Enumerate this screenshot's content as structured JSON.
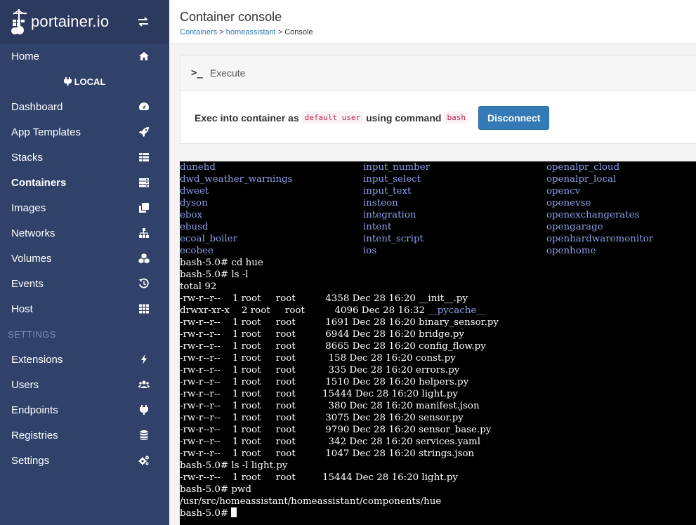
{
  "logo": {
    "text": "portainer.io"
  },
  "sidebar": {
    "home": "Home",
    "endpoint": "LOCAL",
    "items": [
      {
        "label": "Dashboard",
        "icon": "tachometer-icon"
      },
      {
        "label": "App Templates",
        "icon": "rocket-icon"
      },
      {
        "label": "Stacks",
        "icon": "list-icon"
      },
      {
        "label": "Containers",
        "icon": "server-icon",
        "active": true
      },
      {
        "label": "Images",
        "icon": "clone-icon"
      },
      {
        "label": "Networks",
        "icon": "sitemap-icon"
      },
      {
        "label": "Volumes",
        "icon": "cubes-icon"
      },
      {
        "label": "Events",
        "icon": "history-icon"
      },
      {
        "label": "Host",
        "icon": "th-icon"
      }
    ],
    "settings_title": "SETTINGS",
    "settings_items": [
      {
        "label": "Extensions",
        "icon": "bolt-icon"
      },
      {
        "label": "Users",
        "icon": "users-icon"
      },
      {
        "label": "Endpoints",
        "icon": "plug-icon"
      },
      {
        "label": "Registries",
        "icon": "database-icon"
      },
      {
        "label": "Settings",
        "icon": "cogs-icon"
      }
    ]
  },
  "header": {
    "title": "Container console",
    "breadcrumb": {
      "containers": "Containers",
      "sep1": " > ",
      "container": "homeassistant",
      "sep2": " > ",
      "current": "Console"
    }
  },
  "execute": {
    "title": "Execute",
    "text1": "Exec into container as",
    "user": "default user",
    "text2": "using command",
    "command": "bash",
    "button": "Disconnect"
  },
  "terminal": {
    "columns": [
      [
        "dunehd",
        "dwd_weather_warnings",
        "dweet",
        "dyson",
        "ebox",
        "ebusd",
        "ecoal_boiler",
        "ecobee"
      ],
      [
        "input_number",
        "input_select",
        "input_text",
        "insteon",
        "integration",
        "intent",
        "intent_script",
        "ios"
      ],
      [
        "openalpr_cloud",
        "openalpr_local",
        "opencv",
        "openevse",
        "openexchangerates",
        "opengarage",
        "openhardwaremonitor",
        "openhome"
      ]
    ],
    "lines": [
      "bash-5.0# cd hue",
      "bash-5.0# ls -l",
      "total 92",
      "-rw-r--r--    1 root     root          4358 Dec 28 16:20 __init__.py",
      "drwxr-xr-x    2 root     root          4096 Dec 28 16:32 ",
      "-rw-r--r--    1 root     root          1691 Dec 28 16:20 binary_sensor.py",
      "-rw-r--r--    1 root     root          6944 Dec 28 16:20 bridge.py",
      "-rw-r--r--    1 root     root          8665 Dec 28 16:20 config_flow.py",
      "-rw-r--r--    1 root     root           158 Dec 28 16:20 const.py",
      "-rw-r--r--    1 root     root           335 Dec 28 16:20 errors.py",
      "-rw-r--r--    1 root     root          1510 Dec 28 16:20 helpers.py",
      "-rw-r--r--    1 root     root         15444 Dec 28 16:20 light.py",
      "-rw-r--r--    1 root     root           380 Dec 28 16:20 manifest.json",
      "-rw-r--r--    1 root     root          3075 Dec 28 16:20 sensor.py",
      "-rw-r--r--    1 root     root          9790 Dec 28 16:20 sensor_base.py",
      "-rw-r--r--    1 root     root           342 Dec 28 16:20 services.yaml",
      "-rw-r--r--    1 root     root          1047 Dec 28 16:20 strings.json",
      "bash-5.0# ls -l light.py",
      "-rw-r--r--    1 root     root         15444 Dec 28 16:20 light.py",
      "bash-5.0# pwd",
      "/usr/src/homeassistant/homeassistant/components/hue",
      "bash-5.0# "
    ],
    "pycache_dir": "__pycache__"
  },
  "colors": {
    "sidebar": "#30426a",
    "logo_bar": "#2b3a5e",
    "link": "#8f9eea",
    "primary": "#337ab7"
  }
}
